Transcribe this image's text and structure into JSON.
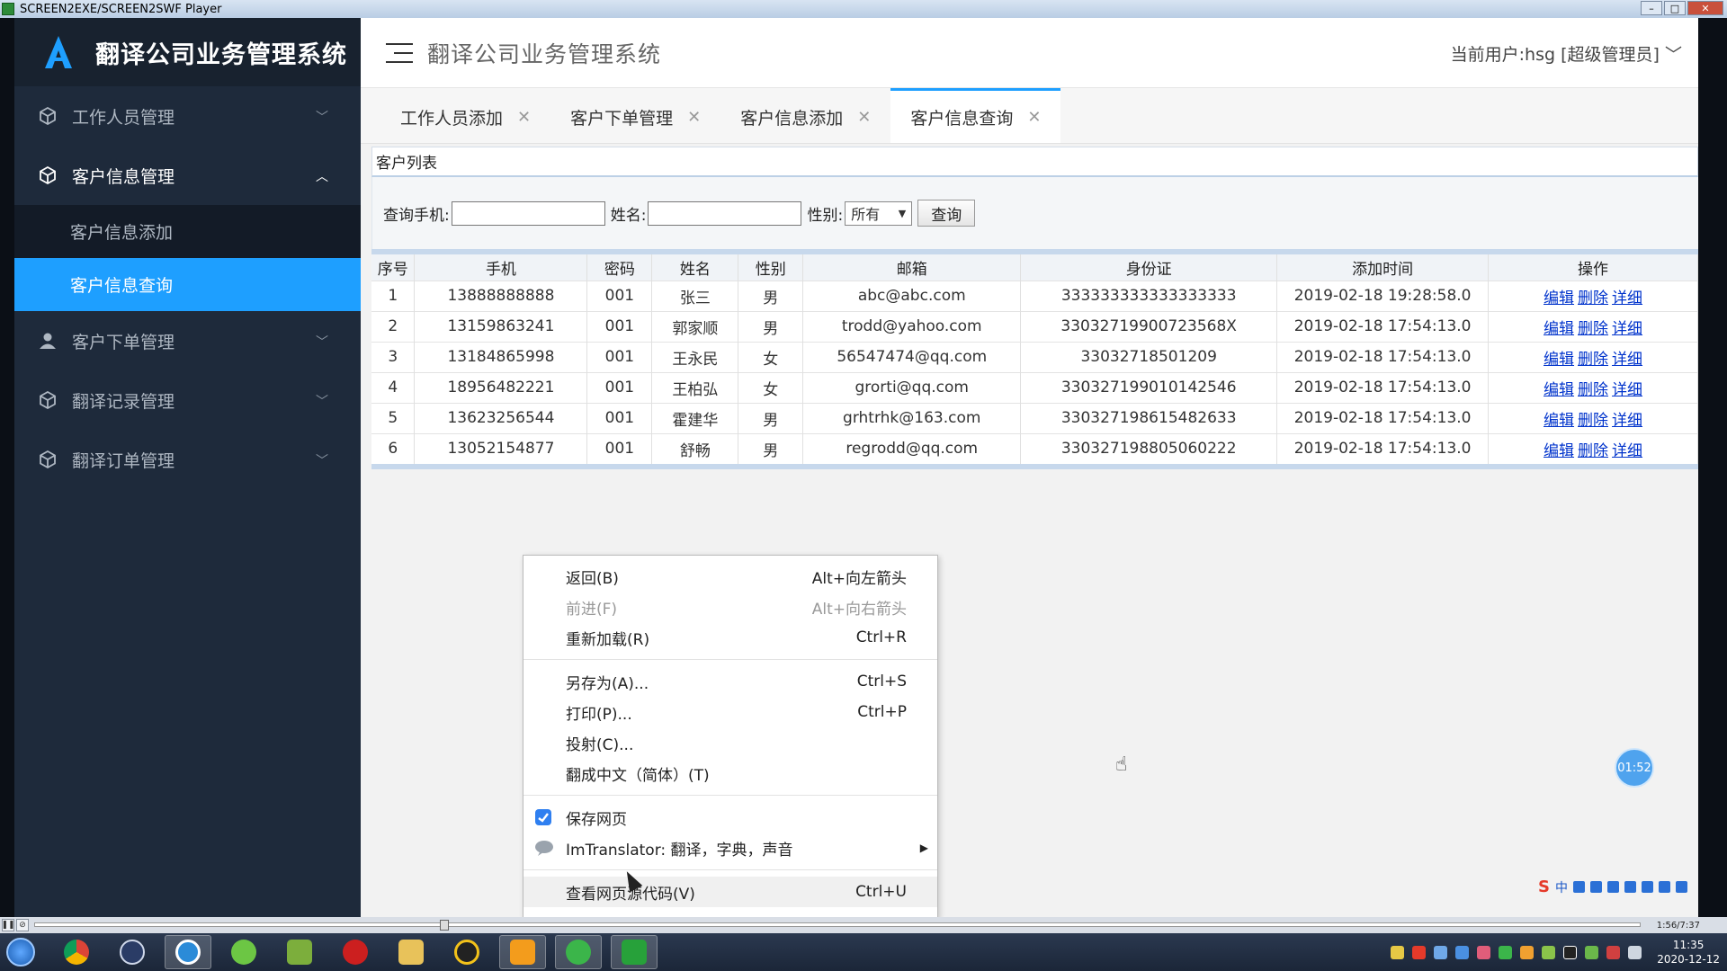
{
  "player": {
    "title": "SCREEN2EXE/SCREEN2SWF Player",
    "time": "1:56/7:37"
  },
  "sidebar": {
    "logo_text": "翻译公司业务管理系统",
    "menu": [
      {
        "label": "工作人员管理",
        "icon": "cube-icon",
        "expanded": false
      },
      {
        "label": "客户信息管理",
        "icon": "cube-icon",
        "expanded": true
      },
      {
        "label": "客户下单管理",
        "icon": "user-icon",
        "expanded": false
      },
      {
        "label": "翻译记录管理",
        "icon": "cube-icon",
        "expanded": false
      },
      {
        "label": "翻译订单管理",
        "icon": "cube-icon",
        "expanded": false
      }
    ],
    "submenu": [
      {
        "label": "客户信息添加",
        "active": false
      },
      {
        "label": "客户信息查询",
        "active": true
      }
    ]
  },
  "header": {
    "title": "翻译公司业务管理系统",
    "user": "当前用户:hsg [超级管理员]"
  },
  "tabs": [
    {
      "label": "工作人员添加",
      "active": false
    },
    {
      "label": "客户下单管理",
      "active": false
    },
    {
      "label": "客户信息添加",
      "active": false
    },
    {
      "label": "客户信息查询",
      "active": true
    }
  ],
  "panel": {
    "title": "客户列表",
    "search": {
      "phone_label": "查询手机:",
      "phone_value": "",
      "name_label": "姓名:",
      "name_value": "",
      "gender_label": "性别:",
      "gender_value": "所有",
      "button": "查询"
    },
    "columns": [
      "序号",
      "手机",
      "密码",
      "姓名",
      "性别",
      "邮箱",
      "身份证",
      "添加时间",
      "操作"
    ],
    "actions": [
      "编辑",
      "删除",
      "详细"
    ],
    "rows": [
      [
        "1",
        "13888888888",
        "001",
        "张三",
        "男",
        "abc@abc.com",
        "333333333333333333",
        "2019-02-18 19:28:58.0"
      ],
      [
        "2",
        "13159863241",
        "001",
        "郭家顺",
        "男",
        "trodd@yahoo.com",
        "33032719900723568X",
        "2019-02-18 17:54:13.0"
      ],
      [
        "3",
        "13184865998",
        "001",
        "王永民",
        "女",
        "56547474@qq.com",
        "33032718501209",
        "2019-02-18 17:54:13.0"
      ],
      [
        "4",
        "18956482221",
        "001",
        "王柏弘",
        "女",
        "grorti@qq.com",
        "330327199010142546",
        "2019-02-18 17:54:13.0"
      ],
      [
        "5",
        "13623256544",
        "001",
        "霍建华",
        "男",
        "grhtrhk@163.com",
        "330327198615482633",
        "2019-02-18 17:54:13.0"
      ],
      [
        "6",
        "13052154877",
        "001",
        "舒畅",
        "男",
        "regrodd@qq.com",
        "330327198805060222",
        "2019-02-18 17:54:13.0"
      ]
    ]
  },
  "context_menu": {
    "items": [
      {
        "label": "返回(B)",
        "shortcut": "Alt+向左箭头",
        "disabled": false
      },
      {
        "label": "前进(F)",
        "shortcut": "Alt+向右箭头",
        "disabled": true
      },
      {
        "label": "重新加载(R)",
        "shortcut": "Ctrl+R",
        "disabled": false
      },
      {
        "label": "另存为(A)...",
        "shortcut": "Ctrl+S",
        "disabled": false
      },
      {
        "label": "打印(P)...",
        "shortcut": "Ctrl+P",
        "disabled": false
      },
      {
        "label": "投射(C)...",
        "shortcut": "",
        "disabled": false
      },
      {
        "label": "翻成中文（简体）(T)",
        "shortcut": "",
        "disabled": false
      },
      {
        "label": "保存网页",
        "shortcut": "",
        "icon": "save-page-icon"
      },
      {
        "label": "ImTranslator: 翻译，字典，声音",
        "shortcut": "",
        "icon": "translator-icon",
        "submenu": true
      },
      {
        "label": "查看网页源代码(V)",
        "shortcut": "Ctrl+U",
        "disabled": false
      }
    ]
  },
  "overlay": {
    "timer": "01:52",
    "ime_label": "中"
  },
  "taskbar": {
    "clock_time": "11:35",
    "clock_date": "2020-12-12"
  },
  "colors": {
    "sidebar_bg": "#1e2a3b",
    "accent": "#1e9fff",
    "link": "#0033cc"
  }
}
